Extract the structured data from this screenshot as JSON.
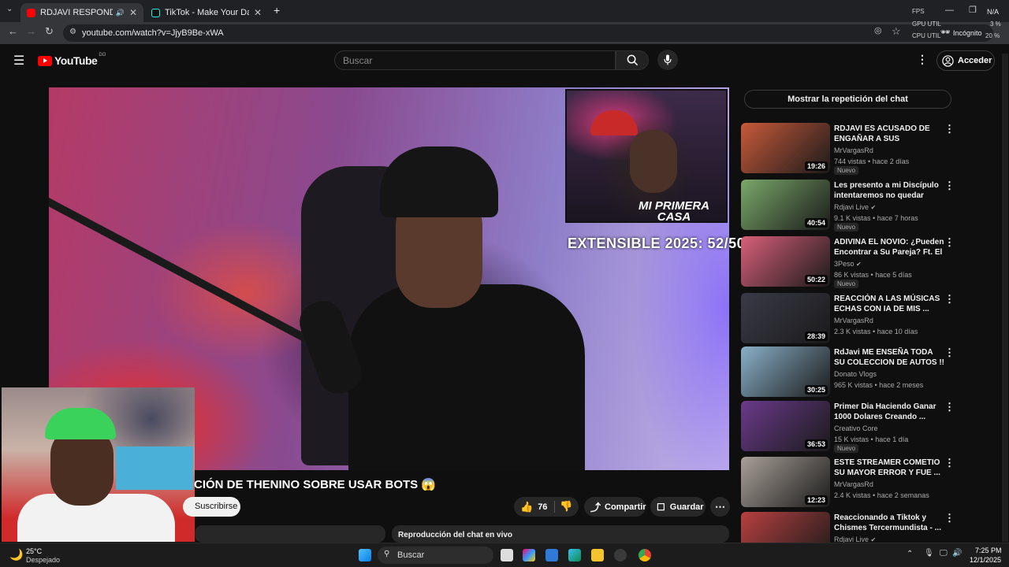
{
  "browser": {
    "tabs": [
      {
        "title": "RDJAVI RESPONDE LA ACU",
        "active": true
      },
      {
        "title": "TikTok - Make Your Day",
        "active": false
      }
    ],
    "new_tab": "+",
    "url": "youtube.com/watch?v=JjyB9Be-xWA",
    "incognito_label": "Incógnito",
    "overlay": {
      "fps": "FPS",
      "gpu": "GPU UTIL",
      "gpu_val": "3 %",
      "cpu": "CPU UTIL",
      "cpu_val": "20 %",
      "na": "N/A"
    }
  },
  "youtube": {
    "logo_text": "YouTube",
    "country": "DO",
    "search_placeholder": "Buscar",
    "sign_in": "Acceder"
  },
  "video": {
    "pip_text": "MI PRIMERA CASA",
    "overlay_text": "EXTENSIBLE 2025: 52/50",
    "title": "CIÓN DE THENINO SOBRE USAR BOTS 😱",
    "subscribe": "Suscribirse",
    "likes": "76",
    "share": "Compartir",
    "save": "Guardar",
    "live_chat_replay": "Reproducción del chat en vivo"
  },
  "sidebar": {
    "chat_replay_button": "Mostrar la repetición del chat",
    "recommendations": [
      {
        "title": "RDJAVI ES ACUSADO DE ENGAÑAR A SUS SEGUIDORE...",
        "channel": "MrVargasRd",
        "views": "744 vistas",
        "age": "hace 2 días",
        "badge": "Nuevo",
        "duration": "19:26",
        "thumb_color": "#c85a3a"
      },
      {
        "title": "Les presento a mi Discípulo intentaremos no quedar Calvo ...",
        "channel": "Rdjavi Live",
        "verified": true,
        "views": "9.1 K vistas",
        "age": "hace 7 horas",
        "badge": "Nuevo",
        "duration": "40:54",
        "thumb_color": "#7aa86a"
      },
      {
        "title": "ADIVINA EL NOVIO: ¿Pueden Encontrar a Su Pareja? Ft. El ...",
        "channel": "3Peso",
        "verified": true,
        "views": "86 K vistas",
        "age": "hace 5 días",
        "badge": "Nuevo",
        "duration": "50:22",
        "thumb_color": "#d8607a"
      },
      {
        "title": "REACCIÓN A LAS MÚSICAS ECHAS CON IA DE MIS ...",
        "channel": "MrVargasRd",
        "views": "2.3 K vistas",
        "age": "hace 10 días",
        "badge": "",
        "duration": "28:39",
        "thumb_color": "#3a3a48"
      },
      {
        "title": "RdJavi ME ENSEÑA TODA SU COLECCION DE AUTOS !! - ...",
        "channel": "Donato Vlogs",
        "views": "965 K vistas",
        "age": "hace 2 meses",
        "badge": "",
        "duration": "30:25",
        "thumb_color": "#8ab0c8"
      },
      {
        "title": "Primer Dia Haciendo Ganar 1000 Dolares Creando ...",
        "channel": "Creativo Core",
        "views": "15 K vistas",
        "age": "hace 1 día",
        "badge": "Nuevo",
        "duration": "36:53",
        "thumb_color": "#6a3a8a"
      },
      {
        "title": "ESTE STREAMER COMETIO SU MAYOR ERROR Y FUE ...",
        "channel": "MrVargasRd",
        "views": "2.4 K vistas",
        "age": "hace 2 semanas",
        "badge": "",
        "duration": "12:23",
        "thumb_color": "#a8a098"
      },
      {
        "title": "Reaccionando a Tiktok y Chismes Tercermundista - ...",
        "channel": "Rdjavi Live",
        "verified": true,
        "views": "",
        "age": "",
        "badge": "",
        "duration": "",
        "thumb_color": "#b84040"
      }
    ]
  },
  "taskbar": {
    "weather_temp": "25°C",
    "weather_desc": "Despejado",
    "search": "Buscar",
    "time": "7:25 PM",
    "date": "12/1/2025"
  }
}
